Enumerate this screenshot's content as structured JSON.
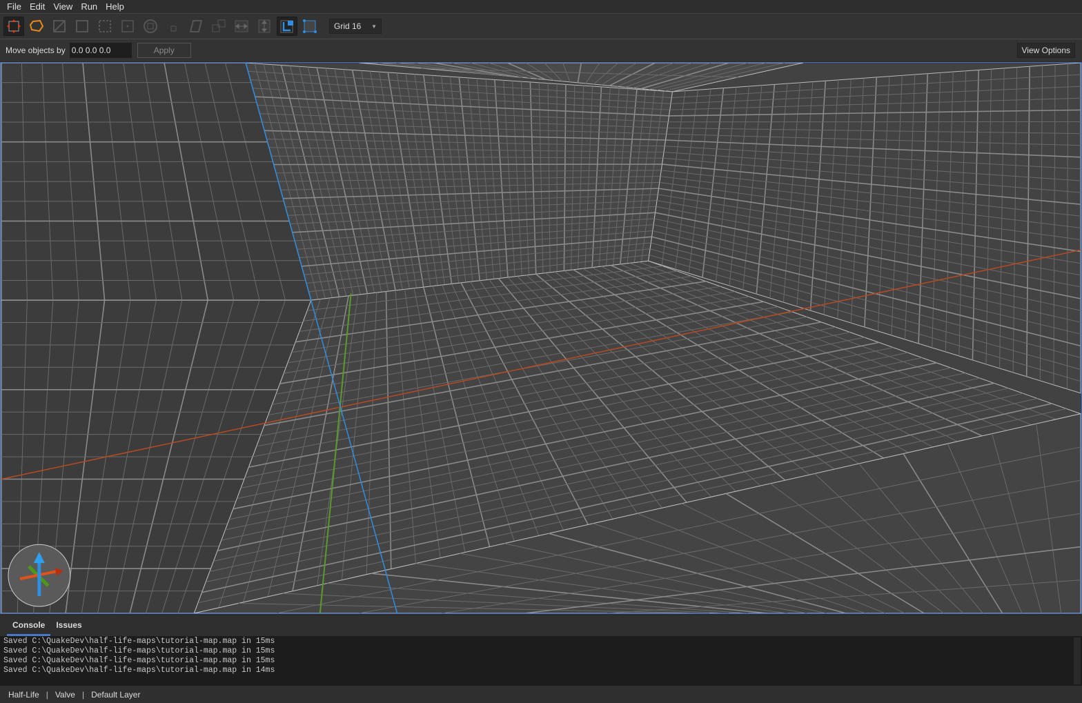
{
  "menu": [
    "File",
    "Edit",
    "View",
    "Run",
    "Help"
  ],
  "toolbar": {
    "grid_select": "Grid 16",
    "icons": [
      "move-tool-icon",
      "brush-tool-icon",
      "clip-tool-icon",
      "vertex-tool-icon",
      "edge-tool-icon",
      "face-tool-icon",
      "rotate-tool-icon",
      "scale-tool-icon",
      "shear-tool-icon",
      "duplicate-icon",
      "flip-horizontal-icon",
      "flip-vertical-icon",
      "texture-lock-icon",
      "uv-lock-icon"
    ]
  },
  "movebar": {
    "label": "Move objects by",
    "value": "0.0 0.0 0.0",
    "apply": "Apply",
    "view_options": "View Options"
  },
  "tabs": [
    "Console",
    "Issues"
  ],
  "console": [
    "Saved C:\\QuakeDev\\half-life-maps\\tutorial-map.map in 15ms",
    "Saved C:\\QuakeDev\\half-life-maps\\tutorial-map.map in 15ms",
    "Saved C:\\QuakeDev\\half-life-maps\\tutorial-map.map in 15ms",
    "Saved C:\\QuakeDev\\half-life-maps\\tutorial-map.map in 14ms"
  ],
  "status": {
    "game": "Half-Life",
    "format": "Valve",
    "layer": "Default Layer"
  },
  "colors": {
    "accent": "#3d6fc2",
    "x_axis": "#e0501a",
    "y_axis": "#5a9a2a",
    "z_axis": "#2e8ee0"
  }
}
